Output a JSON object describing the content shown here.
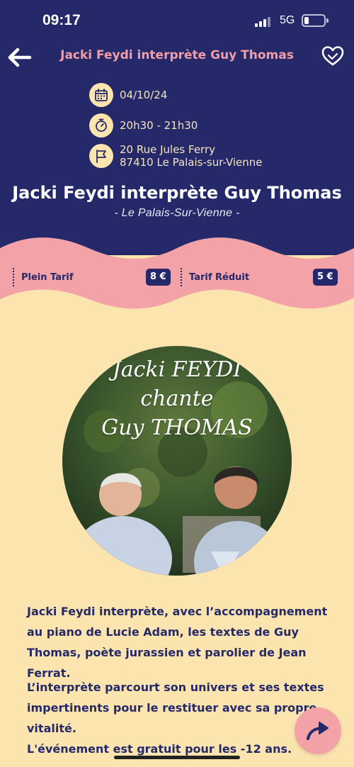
{
  "status_bar": {
    "time": "09:17",
    "network": "5G"
  },
  "header": {
    "title": "Jacki Feydi interprète Guy Thomas"
  },
  "event": {
    "date": "04/10/24",
    "time": "20h30 - 21h30",
    "address_line1": "20 Rue Jules Ferry",
    "address_line2": "87410 Le Palais-sur-Vienne",
    "title": "Jacki Feydi interprète Guy Thomas",
    "city": "- Le Palais-Sur-Vienne -"
  },
  "prices": [
    {
      "label": "Plein Tarif",
      "value": "8 €"
    },
    {
      "label": "Tarif Réduit",
      "value": "5 €"
    }
  ],
  "image": {
    "line1": "Jacki FEYDI",
    "line2": "chante",
    "line3": "Guy THOMAS"
  },
  "description": {
    "p1": "Jacki Feydi interprète, avec l’accompagnement au piano de Lucie Adam, les textes de Guy Thomas, poète jurassien et parolier de Jean Ferrat.",
    "p2": "L’interprète parcourt son univers et ses textes impertinents pour le restituer avec sa propre vitalité.",
    "p3": "L'événement est gratuit pour les -12 ans."
  },
  "icons": {
    "back": "arrow-left-icon",
    "favorite": "heart-icon",
    "date": "calendar-icon",
    "time": "stopwatch-icon",
    "location": "flag-icon",
    "share": "share-arrow-icon"
  },
  "colors": {
    "navy": "#25296a",
    "pink": "#f3a2a7",
    "cream": "#fbe4ae"
  }
}
